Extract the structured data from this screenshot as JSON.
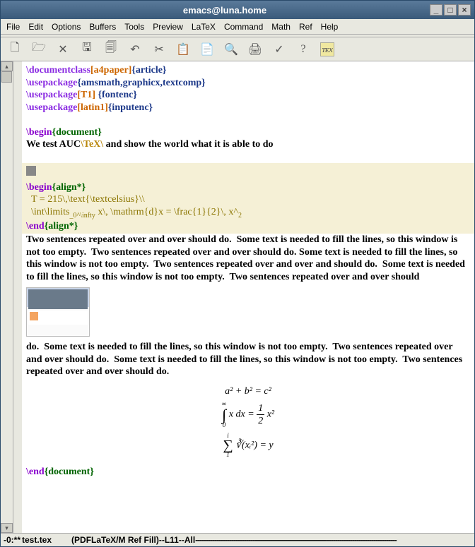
{
  "window": {
    "title": "emacs@luna.home"
  },
  "menu": [
    "File",
    "Edit",
    "Options",
    "Buffers",
    "Tools",
    "Preview",
    "LaTeX",
    "Command",
    "Math",
    "Ref",
    "Help"
  ],
  "toolbar_icons": [
    "file-new",
    "file-open",
    "close",
    "save",
    "save-as",
    "undo",
    "cut",
    "copy",
    "paste",
    "search",
    "print",
    "spell",
    "help",
    "tex-preview"
  ],
  "source": {
    "l1a": "\\documentclass",
    "l1b": "[a4paper]",
    "l1c": "{article}",
    "l2a": "\\usepackage",
    "l2c": "{amsmath,graphicx,textcomp}",
    "l3a": "\\usepackage",
    "l3b": "[T1] ",
    "l3c": "{fontenc}",
    "l4a": "\\usepackage",
    "l4b": "[latin1]",
    "l4c": "{inputenc}",
    "l6a": "\\begin",
    "l6c": "{document}",
    "l7a": "We test AUC",
    "l7b": "\\TeX\\ ",
    "l7c": "and show the world what it is able to do",
    "m1a": "\\begin",
    "m1c": "{align*}",
    "m2": "  T = 215\\,\\text{\\textcelsius}\\\\",
    "m3a": "  \\int\\limits",
    "m3b": "_0^\\infty",
    "m3c": " x\\, \\mathrm{d}x = \\frac{1}{2}\\, x^",
    "m3d": "2",
    "m4a": "\\end",
    "m4c": "{align*}",
    "p1": "Two sentences repeated over and over should do.  Some text is needed to fill the lines, so this window is not too empty.  Two sentences repeated over and over should do. Some text is needed to fill the lines, so this window is not too empty.  Two sentences repeated over and over and should do.  Some text is needed to fill the lines, so this window is not too empty.  Two sentences repeated over and over should",
    "p2": "do.  Some text is needed to fill the lines, so this window is not too empty.  Two sentences repeated over and over should do.  Some text is needed to fill the lines, so this window is not too empty.  Two sentences repeated over and over should do.",
    "eq1": "a² + b² = c²",
    "eq2_int": "∫",
    "eq2_top": "∞",
    "eq2_bot": "0",
    "eq2_body": "x dx = ",
    "eq2_frac_n": "1",
    "eq2_frac_d": "2",
    "eq2_rest": " x²",
    "eq3_sum": "∑",
    "eq3_top": "i",
    "eq3_bot": "1",
    "eq3_root": "∛(xᵢ²) = y",
    "lend_a": "\\end",
    "lend_c": "{document}"
  },
  "modeline": {
    "left": "-0:** ",
    "file": " test.tex",
    "mode": "(PDFLaTeX/M Ref Fill)--L11--All"
  }
}
